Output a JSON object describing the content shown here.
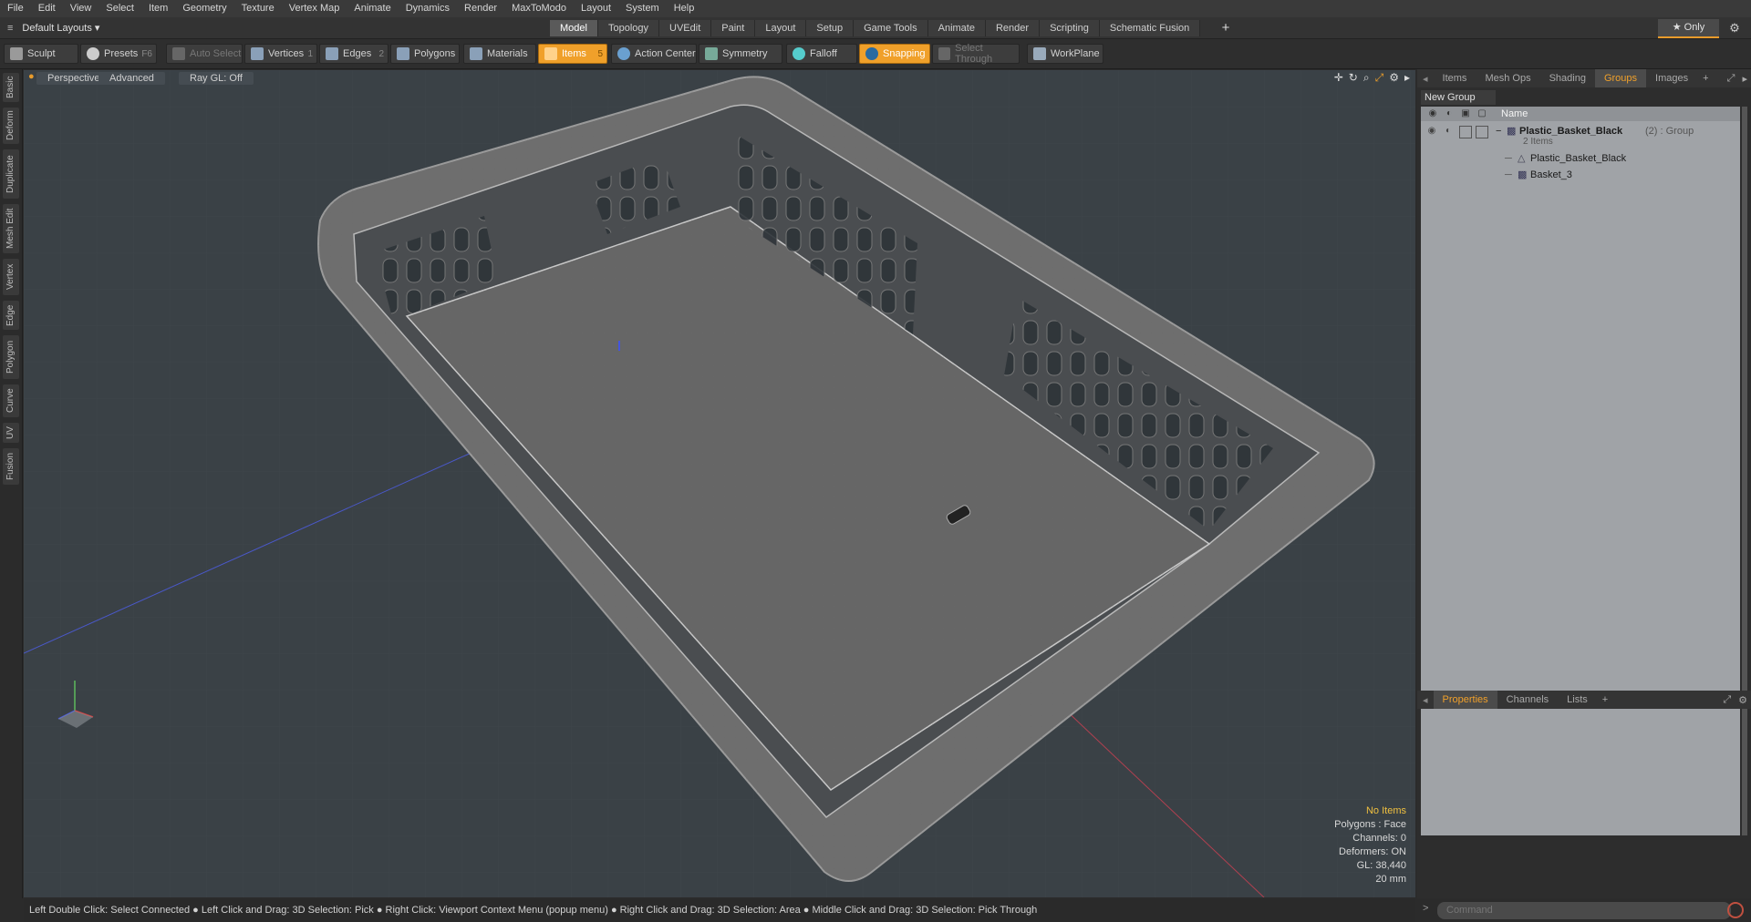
{
  "menu": [
    "File",
    "Edit",
    "View",
    "Select",
    "Item",
    "Geometry",
    "Texture",
    "Vertex Map",
    "Animate",
    "Dynamics",
    "Render",
    "MaxToModo",
    "Layout",
    "System",
    "Help"
  ],
  "layout_select": "Default Layouts ▾",
  "mode_tabs": [
    "Model",
    "Topology",
    "UVEdit",
    "Paint",
    "Layout",
    "Setup",
    "Game Tools",
    "Animate",
    "Render",
    "Scripting",
    "Schematic Fusion"
  ],
  "active_mode_tab": "Model",
  "only_label": "★  Only",
  "toolbar": {
    "sculpt": "Sculpt",
    "presets": "Presets",
    "presets_key": "F6",
    "auto_select": "Auto Select",
    "vertices": "Vertices",
    "vertices_count": "1",
    "edges": "Edges",
    "edges_count": "2",
    "polygons": "Polygons",
    "materials": "Materials",
    "items": "Items",
    "items_count": "5",
    "action_center": "Action Center",
    "symmetry": "Symmetry",
    "falloff": "Falloff",
    "snapping": "Snapping",
    "select_through": "Select Through",
    "workplane": "WorkPlane"
  },
  "left_tabs": [
    "Basic",
    "Deform",
    "Duplicate",
    "Mesh Edit",
    "Vertex",
    "Edge",
    "Polygon",
    "Curve",
    "UV",
    "Fusion"
  ],
  "viewport": {
    "perspective": "Perspective",
    "advanced": "Advanced",
    "raygl": "Ray GL: Off",
    "info": {
      "no_items": "No Items",
      "polygons": "Polygons : Face",
      "channels": "Channels: 0",
      "deformers": "Deformers: ON",
      "gl": "GL: 38,440",
      "scale": "20 mm"
    }
  },
  "right_panel": {
    "tabs": [
      "Items",
      "Mesh Ops",
      "Shading",
      "Groups",
      "Images"
    ],
    "active_tab": "Groups",
    "new_group": "New Group",
    "name_header": "Name",
    "group_name": "Plastic_Basket_Black",
    "group_suffix": "(2) : Group",
    "group_count": "2 Items",
    "children": [
      "Plastic_Basket_Black",
      "Basket_3"
    ],
    "bottom_tabs": [
      "Properties",
      "Channels",
      "Lists"
    ],
    "active_bottom_tab": "Properties",
    "command_placeholder": "Command"
  },
  "status_bar": "Left Double Click: Select Connected ● Left Click and Drag: 3D Selection: Pick ● Right Click: Viewport Context Menu (popup menu) ● Right Click and Drag: 3D Selection: Area ● Middle Click and Drag: 3D Selection: Pick Through",
  "colors": {
    "accent": "#f0a02a",
    "viewport_bg": "#3a4146",
    "panel_bg": "#a0a3a7"
  }
}
